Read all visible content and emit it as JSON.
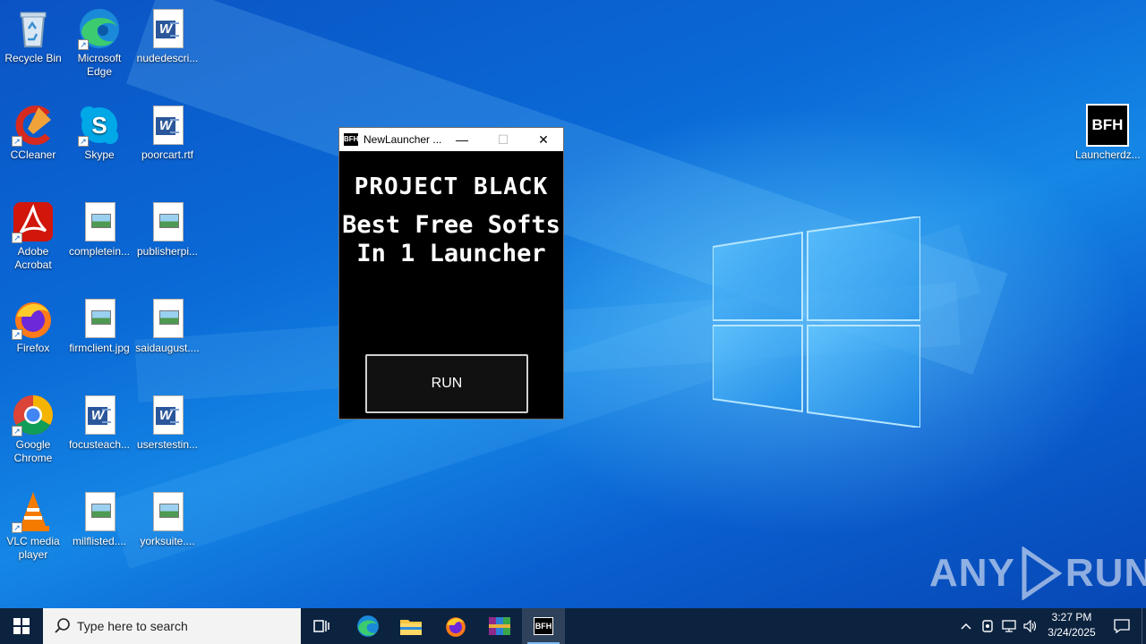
{
  "desktop": {
    "icons": [
      {
        "label": "Recycle Bin"
      },
      {
        "label": "Microsoft Edge"
      },
      {
        "label": "nudedescri..."
      },
      {
        "label": "CCleaner"
      },
      {
        "label": "Skype"
      },
      {
        "label": "poorcart.rtf"
      },
      {
        "label": "Adobe Acrobat"
      },
      {
        "label": "completein..."
      },
      {
        "label": "publisherpi..."
      },
      {
        "label": "Firefox"
      },
      {
        "label": "firmclient.jpg"
      },
      {
        "label": "saidaugust...."
      },
      {
        "label": "Google Chrome"
      },
      {
        "label": "focusteach..."
      },
      {
        "label": "userstestin..."
      },
      {
        "label": "VLC media player"
      },
      {
        "label": "milflisted...."
      },
      {
        "label": "yorksuite...."
      },
      {
        "label": "Launcherdz..."
      }
    ],
    "bfh_icon_text": "BFH"
  },
  "window": {
    "icon_text": "BFH",
    "title": "NewLauncher ...",
    "minimize_glyph": "—",
    "maximize_glyph": "☐",
    "close_glyph": "✕",
    "heading": "PROJECT BLACK",
    "sub_line1": "Best Free Softs",
    "sub_line2": "In 1 Launcher",
    "run_label": "RUN"
  },
  "watermark": {
    "left": "ANY",
    "right": "RUN"
  },
  "taskbar": {
    "search_placeholder": "Type here to search",
    "apps": [
      "task-view",
      "edge",
      "file-explorer",
      "firefox",
      "winrar",
      "bfh-launcher"
    ],
    "active_app": "bfh-launcher",
    "clock_time": "3:27 PM",
    "clock_date": "3/24/2025"
  },
  "colors": {
    "desktop_blue": "#0a63c9",
    "taskbar": "#0c2340",
    "window_bg": "#000000",
    "word_blue": "#2b579a"
  }
}
